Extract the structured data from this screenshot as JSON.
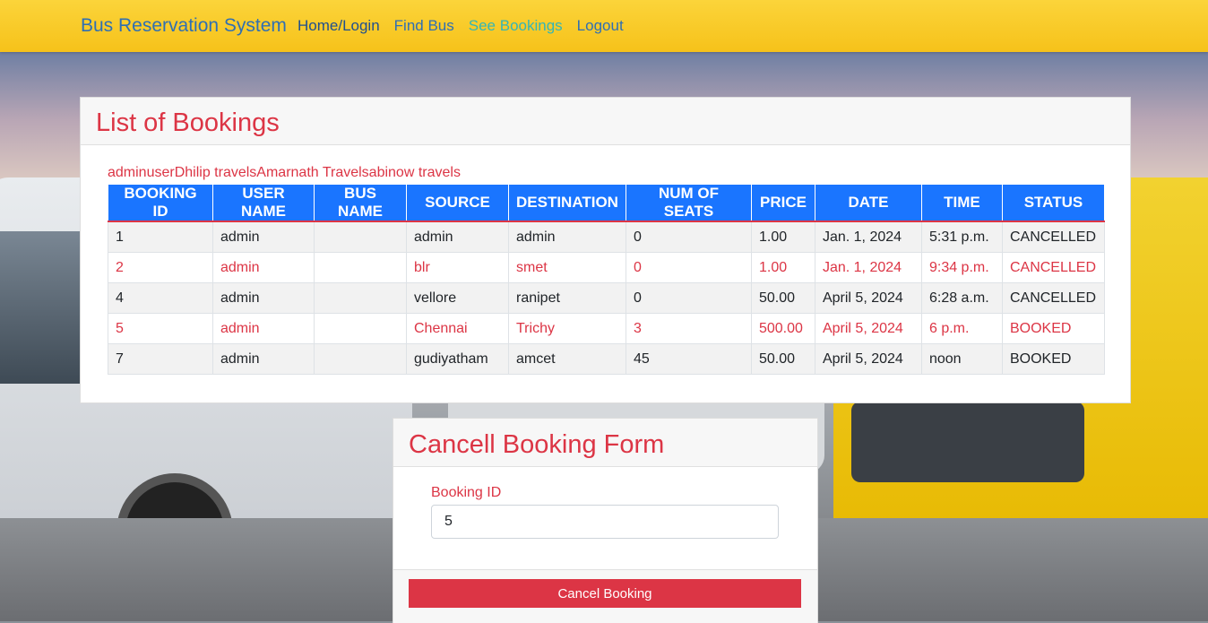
{
  "navbar": {
    "brand": "Bus Reservation System",
    "links": {
      "home": "Home/Login",
      "find": "Find Bus",
      "see": "See Bookings",
      "logout": "Logout"
    }
  },
  "bookings": {
    "title": "List of Bookings",
    "bus_names_line": "adminuserDhilip travelsAmarnath Travelsabinow travels",
    "columns": [
      "BOOKING ID",
      "USER NAME",
      "BUS NAME",
      "SOURCE",
      "DESTINATION",
      "NUM OF SEATS",
      "PRICE",
      "DATE",
      "TIME",
      "STATUS"
    ],
    "rows": [
      {
        "id": "1",
        "user": "admin",
        "bus": "",
        "source": "admin",
        "destination": "admin",
        "seats": "0",
        "price": "1.00",
        "date": "Jan. 1, 2024",
        "time": "5:31 p.m.",
        "status": "CANCELLED"
      },
      {
        "id": "2",
        "user": "admin",
        "bus": "",
        "source": "blr",
        "destination": "smet",
        "seats": "0",
        "price": "1.00",
        "date": "Jan. 1, 2024",
        "time": "9:34 p.m.",
        "status": "CANCELLED"
      },
      {
        "id": "4",
        "user": "admin",
        "bus": "",
        "source": "vellore",
        "destination": "ranipet",
        "seats": "0",
        "price": "50.00",
        "date": "April 5, 2024",
        "time": "6:28 a.m.",
        "status": "CANCELLED"
      },
      {
        "id": "5",
        "user": "admin",
        "bus": "",
        "source": "Chennai",
        "destination": "Trichy",
        "seats": "3",
        "price": "500.00",
        "date": "April 5, 2024",
        "time": "6 p.m.",
        "status": "BOOKED"
      },
      {
        "id": "7",
        "user": "admin",
        "bus": "",
        "source": "gudiyatham",
        "destination": "amcet",
        "seats": "45",
        "price": "50.00",
        "date": "April 5, 2024",
        "time": "noon",
        "status": "BOOKED"
      }
    ]
  },
  "cancel_form": {
    "title": "Cancell Booking Form",
    "field_label": "Booking ID",
    "field_value": "5",
    "button_label": "Cancel Booking"
  },
  "colors": {
    "navbar": "#f6c21a",
    "accent_red": "#dc3545",
    "header_blue": "#1a75ff"
  }
}
